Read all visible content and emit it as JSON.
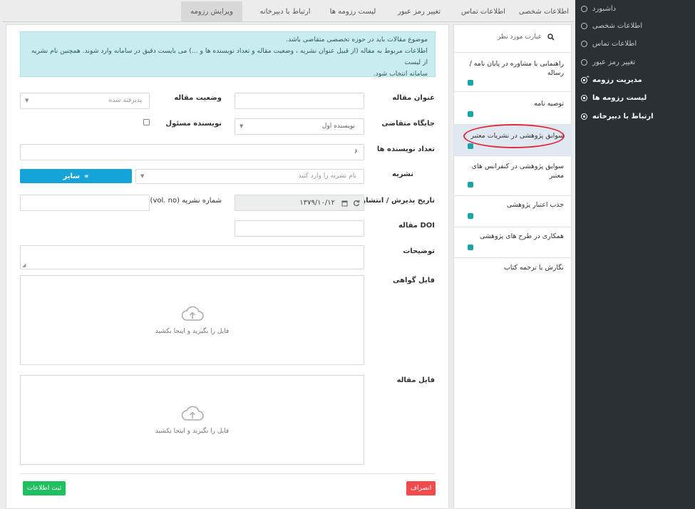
{
  "nav": {
    "items": [
      {
        "label": "داشبورد"
      },
      {
        "label": "اطلاعات شخصی"
      },
      {
        "label": "اطلاعات تماس"
      },
      {
        "label": "تغییر رمز عبور"
      },
      {
        "label": "مدیریت رزومه"
      },
      {
        "label": "لیست رزومه ها"
      },
      {
        "label": "ارتباط با دبیرخانه"
      }
    ],
    "expand_glyph": "⌃"
  },
  "tabs": [
    {
      "label": "اطلاعات شخصی"
    },
    {
      "label": "اطلاعات تماس"
    },
    {
      "label": "تغییر رمز عبور"
    },
    {
      "label": "لیست رزومه ها"
    },
    {
      "label": "ارتباط با دبیرخانه"
    },
    {
      "label": "ویرایش رزومه"
    }
  ],
  "alert": {
    "line1": "موضوع مقالات باید در حوزه تخصصی متقاضی باشد.",
    "line2": "اطلاعات مربوط به مقاله (از قبیل عنوان نشریه ، وضعیت مقاله و تعداد نویسنده ها و ...) می بایست دقیق در سامانه وارد شوند. همچنین نام نشریه از لیست",
    "line3": "سامانه انتخاب شود."
  },
  "form": {
    "title_label": "عنوان مقاله",
    "status_label": "وضعیت مقاله",
    "status_value": "پذیرفته شده",
    "position_label": "جایگاه متقاضی",
    "position_value": "نویسنده اول",
    "corresponding_label": "نویسنده مسئول",
    "authors_count_label": "تعداد نویسنده ها",
    "authors_count_value": "۶",
    "journal_label": "نشریه",
    "journal_placeholder": "نام نشریه را وارد کنید",
    "other_button": "سایر",
    "date_label": "تاریخ پذیرش / انتشار",
    "date_value": "۱۳۷۹/۱۰/۱۲",
    "issue_label": "شماره نشریه (vol. no)",
    "doi_label": "DOI مقاله",
    "desc_label": "توضیحات",
    "cert_file_label": "فایل گواهی",
    "article_file_label": "فایل مقاله",
    "dropzone_text": "فایل را بگیرید و اینجا بکشید",
    "cancel_button": "انصراف",
    "save_button": "ثبت اطلاعات"
  },
  "list": {
    "search_placeholder": "عبارت مورد نظر",
    "categories": [
      {
        "label": "راهنمایی یا مشاوره در پایان نامه / رساله"
      },
      {
        "label": "توصیه نامه"
      },
      {
        "label": "سوابق پژوهشی در نشریات معتبر"
      },
      {
        "label": "سوابق پژوهشی در کنفرانس های معتبر"
      },
      {
        "label": "جذب اعتبار پژوهشی"
      },
      {
        "label": "همکاری در طرح های پژوهشی"
      },
      {
        "label": "نگارش یا ترجمه کتاب"
      }
    ]
  },
  "colors": {
    "nav_bg": "#2b3035",
    "accent_blue": "#16a3d9",
    "alert_bg": "#c8ecef",
    "cancel_red": "#f04a4a",
    "save_green": "#1fbe5e",
    "badge_teal": "#19a4a8",
    "highlight_ring": "#e12a3b"
  }
}
